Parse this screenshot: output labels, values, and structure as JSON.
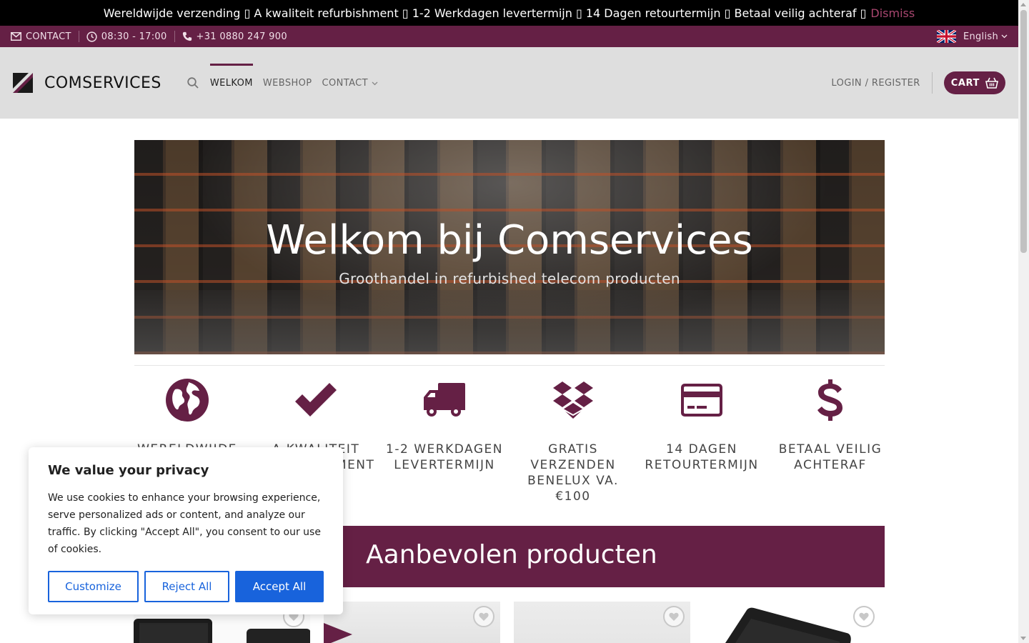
{
  "notice": {
    "text": "Wereldwijde verzending ▯ A kwaliteit refurbishment ▯ 1-2 Werkdagen levertermijn ▯ 14 Dagen retourtermijn ▯ Betaal veilig achteraf ▯",
    "dismiss": "Dismiss"
  },
  "topbar": {
    "contact": "CONTACT",
    "hours": "08:30 - 17:00",
    "phone": "+31 0880 247 900",
    "language": "English"
  },
  "header": {
    "logo": "COMSERVICES",
    "nav": [
      {
        "label": "WELKOM"
      },
      {
        "label": "WEBSHOP"
      },
      {
        "label": "CONTACT"
      }
    ],
    "login": "LOGIN / REGISTER",
    "cart": "CART"
  },
  "hero": {
    "title": "Welkom bij Comservices",
    "subtitle": "Groothandel in refurbished telecom producten"
  },
  "features": [
    {
      "icon": "globe-icon",
      "label": "WERELDWIJDE VERZENDING"
    },
    {
      "icon": "check-icon",
      "label": "A KWALITEIT REFURBISHMENT"
    },
    {
      "icon": "truck-icon",
      "label": "1-2 WERKDAGEN LEVERTERMIJN"
    },
    {
      "icon": "dropbox-icon",
      "label": "GRATIS VERZENDEN BENELUX VA. €100"
    },
    {
      "icon": "credit-card-icon",
      "label": "14 DAGEN RETOURTERMIJN"
    },
    {
      "icon": "dollar-icon",
      "label": "BETAAL VEILIG ACHTERAF"
    }
  ],
  "recommended": {
    "title": "Aanbevolen producten"
  },
  "cookie": {
    "title": "We value your privacy",
    "text": "We use cookies to enhance your browsing experience, serve personalized ads or content, and analyze our traffic. By clicking \"Accept All\", you consent to our use of cookies.",
    "customize": "Customize",
    "reject": "Reject All",
    "accept": "Accept All"
  },
  "colors": {
    "brand": "#652045",
    "accept_blue": "#1863dc"
  }
}
